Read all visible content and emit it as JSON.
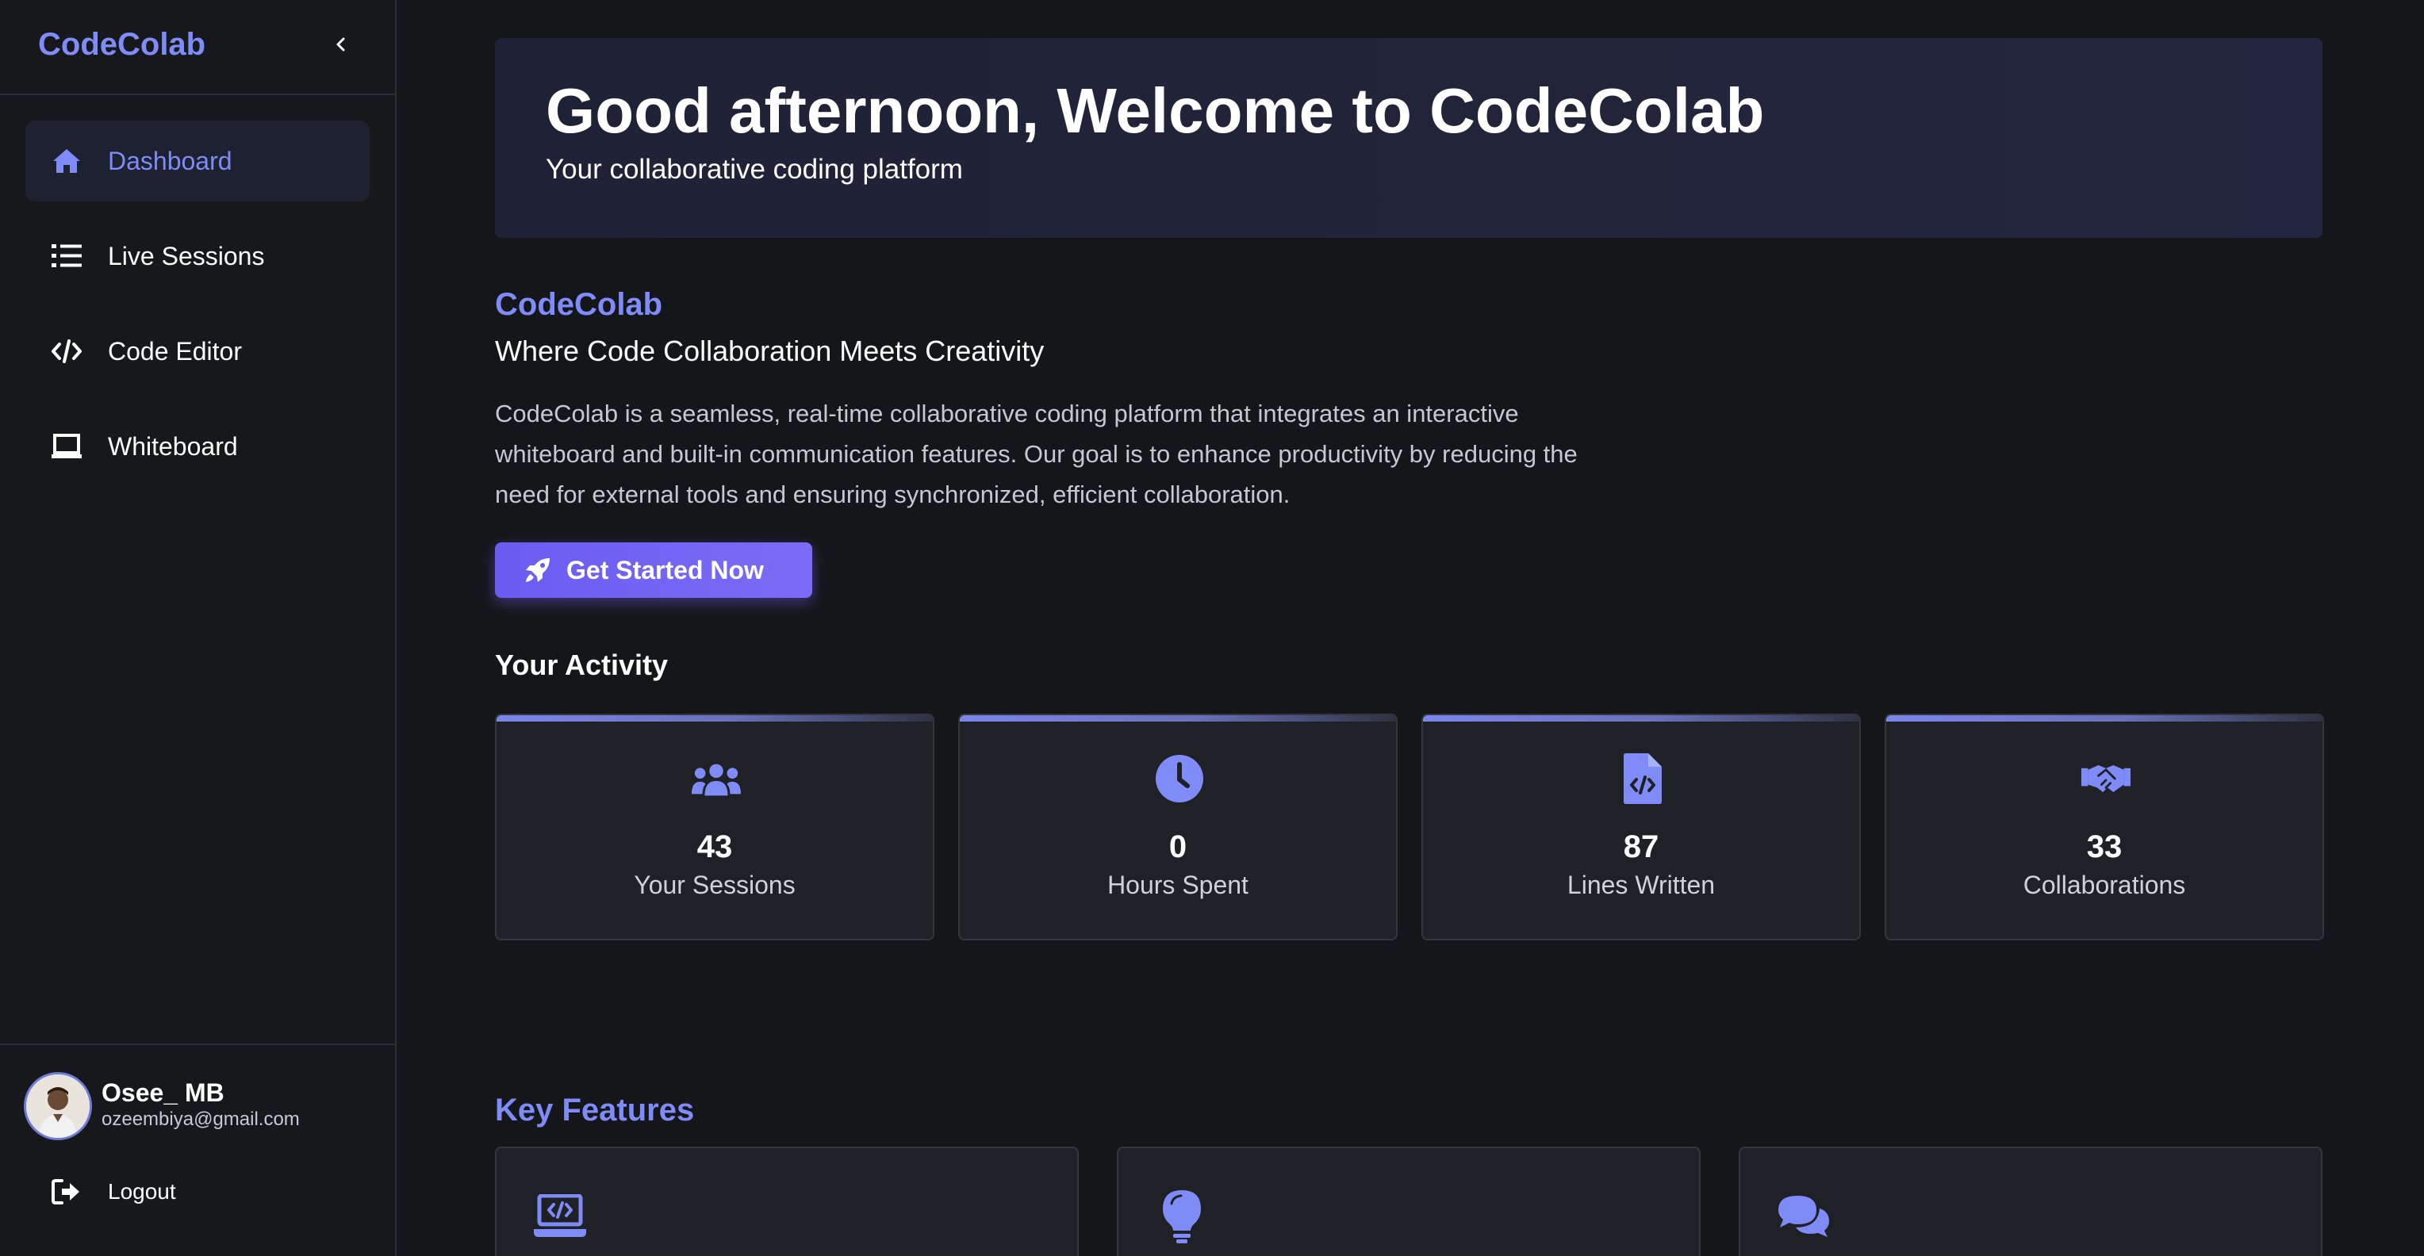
{
  "sidebar": {
    "brand": "CodeColab",
    "collapse_icon": "chevron-left-icon",
    "items": [
      {
        "label": "Dashboard",
        "icon": "home-icon",
        "active": true
      },
      {
        "label": "Live Sessions",
        "icon": "list-icon",
        "active": false
      },
      {
        "label": "Code Editor",
        "icon": "code-icon",
        "active": false
      },
      {
        "label": "Whiteboard",
        "icon": "laptop-icon",
        "active": false
      }
    ],
    "user": {
      "name": "Osee_ MB",
      "email": "ozeembiya@gmail.com"
    },
    "logout_label": "Logout"
  },
  "hero": {
    "title": "Good afternoon, Welcome to CodeColab",
    "subtitle": "Your collaborative coding platform"
  },
  "about": {
    "title": "CodeColab",
    "tagline": "Where Code Collaboration Meets Creativity",
    "description": "CodeColab is a seamless, real-time collaborative coding platform that integrates an interactive whiteboard and built-in communication features. Our goal is to enhance productivity by reducing the need for external tools and ensuring synchronized, efficient collaboration.",
    "cta_label": "Get Started Now",
    "cta_icon": "rocket-icon"
  },
  "activity": {
    "title": "Your Activity",
    "stats": [
      {
        "value": "43",
        "label": "Your Sessions",
        "icon": "users-icon"
      },
      {
        "value": "0",
        "label": "Hours Spent",
        "icon": "clock-icon"
      },
      {
        "value": "87",
        "label": "Lines Written",
        "icon": "code-file-icon"
      },
      {
        "value": "33",
        "label": "Collaborations",
        "icon": "handshake-icon"
      }
    ]
  },
  "features": {
    "title": "Key Features",
    "cards": [
      {
        "icon": "laptop-code-icon"
      },
      {
        "icon": "lightbulb-icon"
      },
      {
        "icon": "comments-icon"
      }
    ]
  },
  "colors": {
    "accent": "#7f8cf7",
    "cta": "#6a5cf0",
    "background": "#15161a",
    "sidebar": "#17181c",
    "card": "#1f2126"
  }
}
